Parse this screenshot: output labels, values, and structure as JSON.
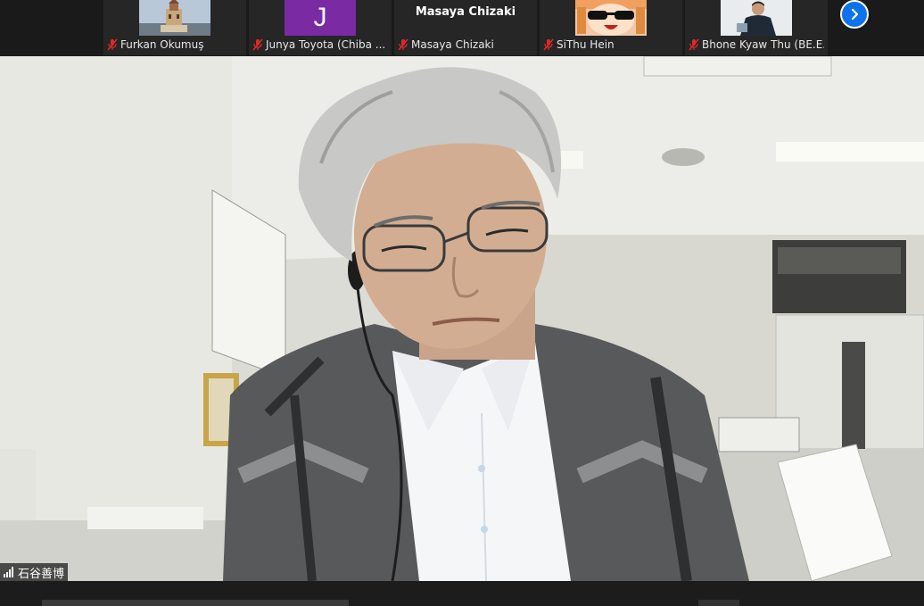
{
  "participants": [
    {
      "name": "Furkan Okumuş",
      "muted": true,
      "avatar": "tower-photo"
    },
    {
      "name": "Junya Toyota (Chiba ...",
      "muted": true,
      "avatar": "initial-letter",
      "initial": "J",
      "avatar_color": "#7a2aa3"
    },
    {
      "name": "Masaya Chizaki",
      "muted": true,
      "avatar": "name-only",
      "display_text": "Masaya Chizaki"
    },
    {
      "name": "SiThu Hein",
      "muted": true,
      "avatar": "cartoon-sunglasses"
    },
    {
      "name": "Bhone Kyaw Thu (BE.E...",
      "muted": true,
      "avatar": "person-photo"
    }
  ],
  "active_speaker": {
    "name": "石谷善博",
    "signal_icon": "signal-bars-icon"
  },
  "controls": {
    "next_page_icon": "chevron-right-icon"
  },
  "colors": {
    "accent": "#0e72ed",
    "muted_red": "#e02828",
    "tile_bg": "#262626"
  }
}
